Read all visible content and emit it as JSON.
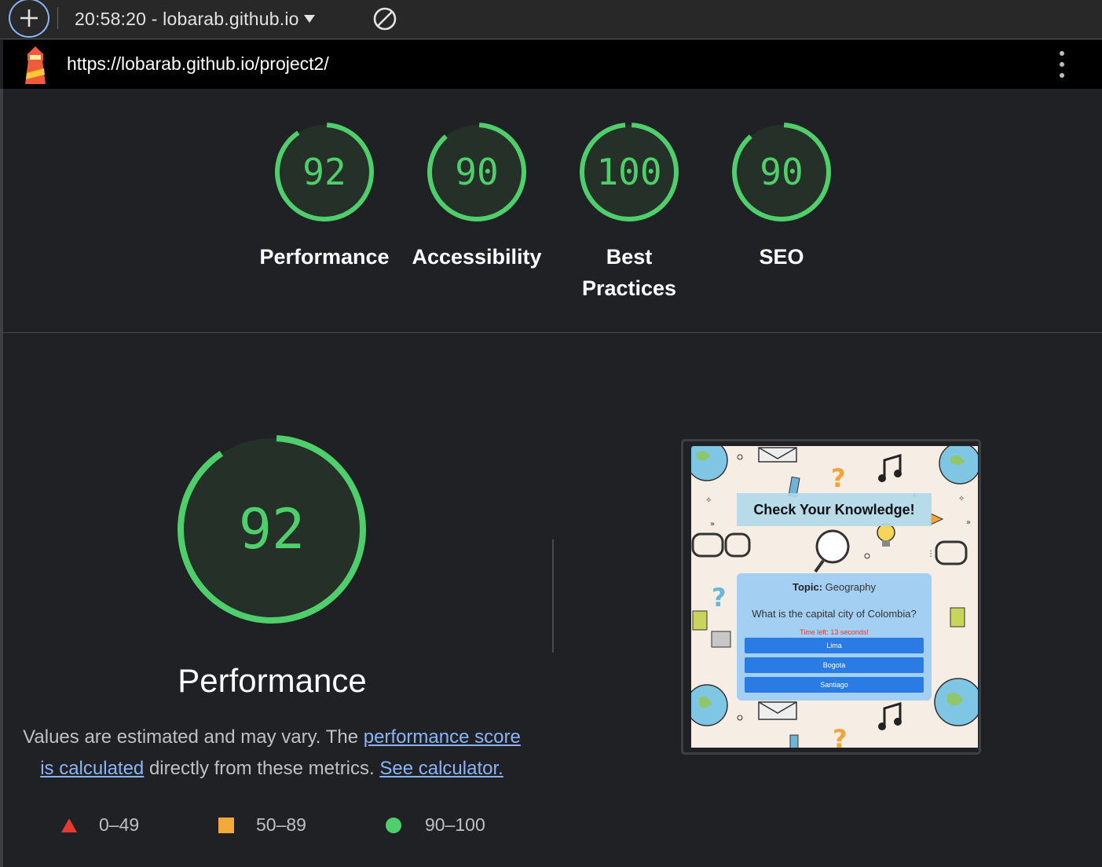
{
  "toolbar": {
    "report_label": "20:58:20 - lobarab.github.io"
  },
  "urlbar": {
    "url": "https://lobarab.github.io/project2/"
  },
  "summary": {
    "gauges": [
      {
        "score": "92",
        "label_line1": "Performance",
        "label_line2": "",
        "value": 92
      },
      {
        "score": "90",
        "label_line1": "Accessibility",
        "label_line2": "",
        "value": 90
      },
      {
        "score": "100",
        "label_line1": "Best",
        "label_line2": "Practices",
        "value": 100
      },
      {
        "score": "90",
        "label_line1": "SEO",
        "label_line2": "",
        "value": 90
      }
    ]
  },
  "performance": {
    "score": "92",
    "value": 92,
    "title": "Performance",
    "desc_prefix": "Values are estimated and may vary. The ",
    "desc_link1": "performance score is calculated",
    "desc_middle": " directly from these metrics. ",
    "desc_link2": "See calculator."
  },
  "legend": {
    "fail": "0–49",
    "average": "50–89",
    "pass": "90–100"
  },
  "screenshot": {
    "banner": "Check Your Knowledge!",
    "topic_label": "Topic:",
    "topic_value": " Geography",
    "question": "What is the capital city of Colombia?",
    "timer": "Time left: 13 seconds!",
    "answers": [
      "Lima",
      "Bogota",
      "Santiago"
    ]
  },
  "colors": {
    "pass": "#4fcf6b",
    "average": "#f4a83a",
    "fail": "#e53935",
    "link": "#8ab4f8"
  },
  "icons": {
    "add": "plus-circle-icon",
    "clear": "block-icon",
    "logo": "lighthouse-icon",
    "menu": "kebab-menu-icon"
  }
}
